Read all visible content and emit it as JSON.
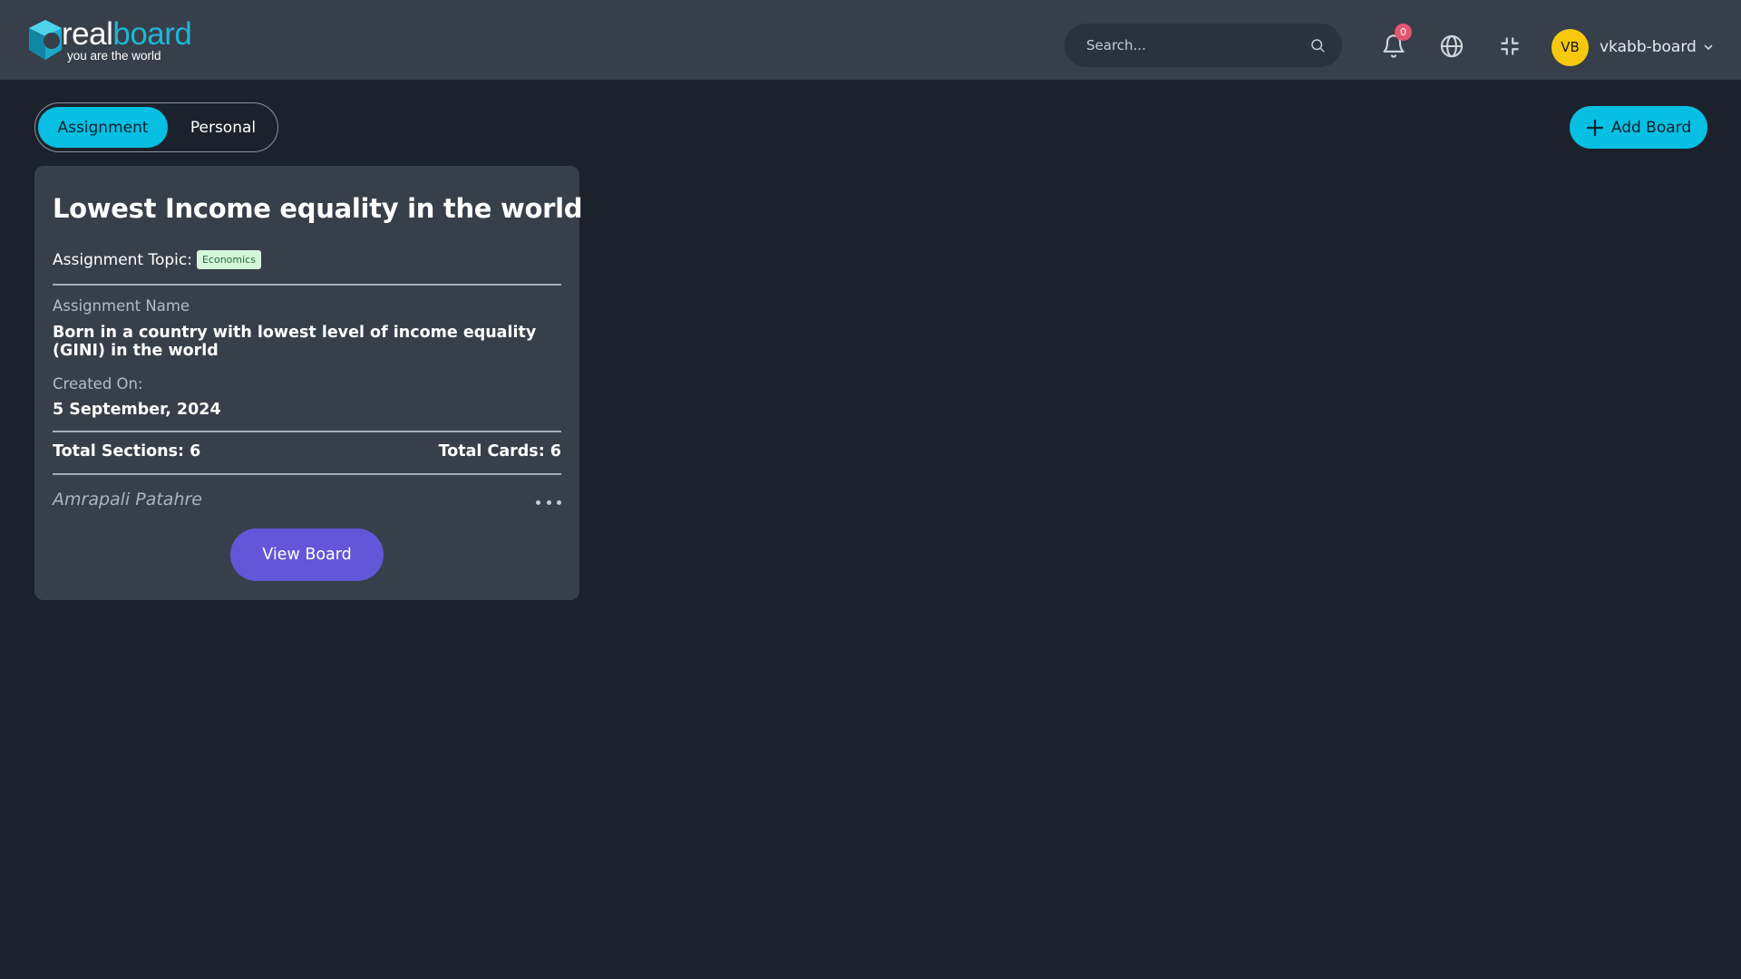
{
  "brand": {
    "word_part1": "real",
    "word_part2": "board",
    "tagline": "you are the world"
  },
  "header": {
    "search_placeholder": "Search...",
    "notification_count": "0",
    "user": {
      "initials": "VB",
      "name": "vkabb-board"
    }
  },
  "tabs": [
    {
      "label": "Assignment",
      "active": true
    },
    {
      "label": "Personal",
      "active": false
    }
  ],
  "add_board_label": "Add Board",
  "boards": [
    {
      "title": "Lowest Income equality in the world",
      "topic_label": "Assignment Topic:",
      "topic_tag": "Economics",
      "assignment_name_label": "Assignment Name",
      "assignment_name": "Born in a country with lowest level of income equality (GINI) in the world",
      "created_label": "Created On:",
      "created_value": "5 September, 2024",
      "total_sections": "Total Sections: 6",
      "total_cards": "Total Cards: 6",
      "author": "Amrapali Patahre",
      "view_button": "View Board"
    }
  ],
  "colors": {
    "accent": "#06bfe2",
    "primary_button": "#6456d8",
    "header_bg": "#373f4b",
    "page_bg": "#1c222c",
    "badge": "#e5566e",
    "avatar": "#f6c90e"
  }
}
